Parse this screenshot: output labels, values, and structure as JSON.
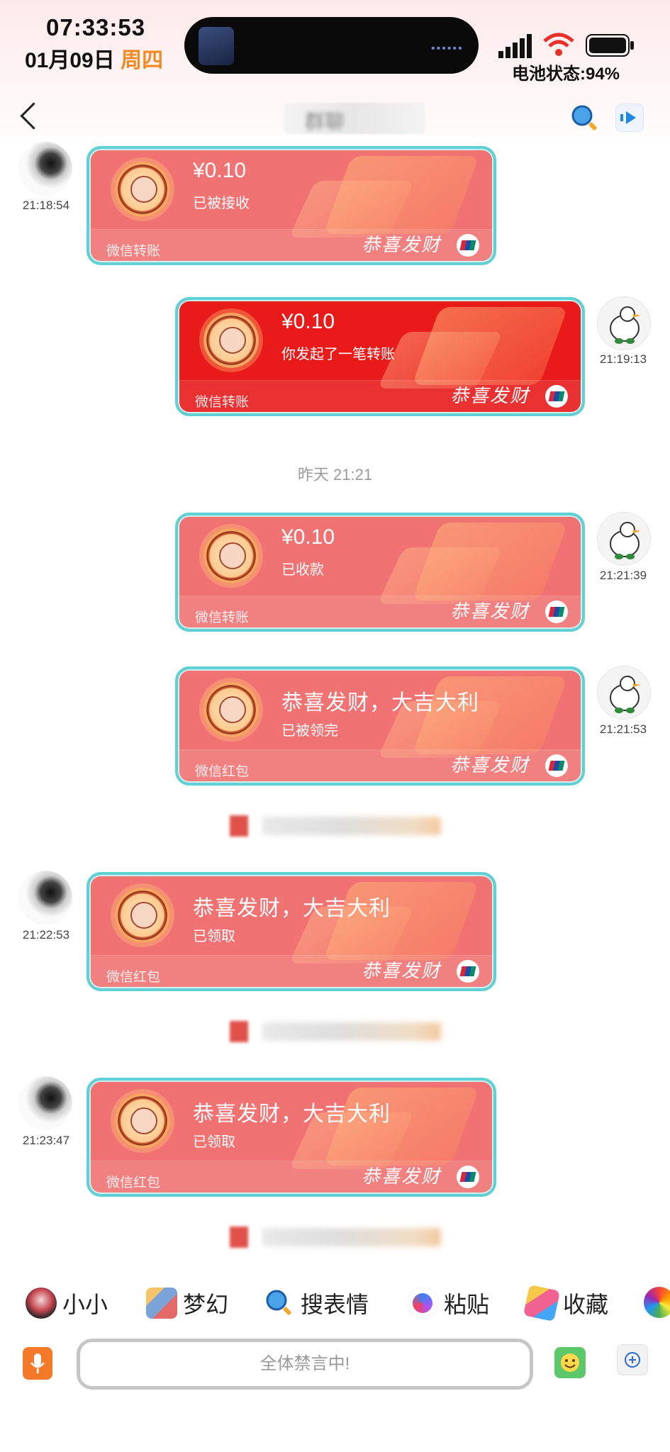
{
  "status_bar": {
    "time": "07:33:53",
    "date": "01月09日",
    "weekday": "周四",
    "battery_label": "电池状态:94%"
  },
  "nav": {
    "title": "群聊"
  },
  "messages": [
    {
      "side": "left",
      "time": "21:18:54",
      "amount": "¥0.10",
      "status": "已被接收",
      "kind": "微信转账",
      "slogan": "恭喜发财"
    },
    {
      "side": "right",
      "time": "21:19:13",
      "amount": "¥0.10",
      "status": "你发起了一笔转账",
      "kind": "微信转账",
      "slogan": "恭喜发财"
    },
    {
      "side": "right",
      "time": "21:21:39",
      "amount": "¥0.10",
      "status": "已收款",
      "kind": "微信转账",
      "slogan": "恭喜发财"
    },
    {
      "side": "right",
      "time": "21:21:53",
      "title": "恭喜发财，大吉大利",
      "status": "已被领完",
      "kind": "微信红包",
      "slogan": "恭喜发财"
    },
    {
      "side": "left",
      "time": "21:22:53",
      "title": "恭喜发财，大吉大利",
      "status": "已领取",
      "kind": "微信红包",
      "slogan": "恭喜发财"
    },
    {
      "side": "left",
      "time": "21:23:47",
      "title": "恭喜发财，大吉大利",
      "status": "已领取",
      "kind": "微信红包",
      "slogan": "恭喜发财"
    }
  ],
  "divider": "昨天 21:21",
  "toolbar": {
    "items": [
      "小小",
      "梦幻",
      "搜表情",
      "粘贴",
      "收藏"
    ]
  },
  "input": {
    "placeholder": "全体禁言中!"
  },
  "colors": {
    "card_received": "#f07272",
    "card_sent": "#e81a1a",
    "card_border": "#5fd0d4",
    "accent_orange": "#f08a24"
  }
}
